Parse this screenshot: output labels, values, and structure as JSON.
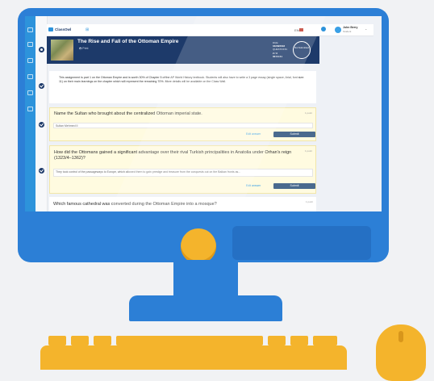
{
  "app": {
    "name": "ClassOwl"
  },
  "topbar": {
    "lang": "ENG",
    "user_name": "John Berry",
    "user_role": "Student"
  },
  "assignment": {
    "title": "The Rise and Fall of the Ottoman Empire",
    "print_label": "Print",
    "due_label": "DUE:",
    "due_date": "04/08/2018",
    "questions_label": "QUESTIONS:",
    "questions_value": "2 / 3",
    "time": "00:04:41",
    "ring_label": "Not Submitted",
    "description": "This assignment is part 1 on the Ottoman Empire and is worth 30% of Chapter 5 of the AP World History textbook. Students will also have to write a 3 page essay (single space, Arial, font size: 11) on their main learnings on the chapter which will represent the remaining 70%. More details will be available on the Class Wall."
  },
  "questions": [
    {
      "title": "Name the Sultan who brought about the centralized Ottoman imperial state.",
      "points": "1 point",
      "answer": "Sultan Mehmed II",
      "edit_label": "Edit answer",
      "submit_label": "Submit"
    },
    {
      "title": "How did the Ottomans gained a significant advantage over their rival Turkish principalities in Anatolia under Orhan's reign (1323/4–1362)?",
      "points": "1 point",
      "answer": "They took control of the passageways to Europe, which allowed them to gain prestige and treasure from the conquests out on the Balkan fronts as...",
      "edit_label": "Edit answer",
      "submit_label": "Submit"
    },
    {
      "title": "Which famous cathedral was converted during the Ottoman Empire into a mosque?",
      "points": "1 point"
    }
  ],
  "colors": {
    "monitor": "#2c7fd6",
    "accent": "#f4b42c",
    "header": "#1d3a6a",
    "question_bg": "#fffbe0"
  }
}
